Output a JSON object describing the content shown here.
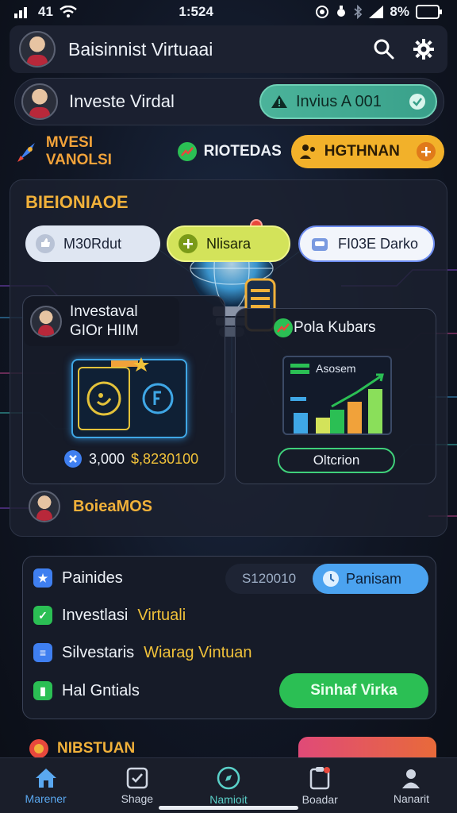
{
  "status_bar": {
    "signal_text": "41",
    "time": "1:524",
    "battery": "8%"
  },
  "app_bar": {
    "title": "Baisinnist Virtuaai",
    "icons": [
      "search-icon",
      "gear-icon"
    ]
  },
  "profile_bar": {
    "name": "Investe Virdal",
    "invite_label": "Invius A 001"
  },
  "chips": {
    "chip1": "MVESI VANOLSI",
    "chip2": "RIOTEDAS",
    "chip3": "HGTHNAN"
  },
  "panel": {
    "section_title": "BIEIONIAOE",
    "pills": [
      "M30Rdut",
      "Nlisara",
      "FI03E Darko"
    ],
    "left_card": {
      "user_line1": "Investaval",
      "user_line2": "GIOr HIIM",
      "money1": "3,000",
      "money2": "$,8230100"
    },
    "right_card": {
      "title": "Pola Kubars",
      "chart_label": "Asosem",
      "button": "Oltcrion"
    }
  },
  "boards_title": "BoieaMOS",
  "list": {
    "rows": [
      {
        "label": "Painides",
        "highlight": ""
      },
      {
        "label": "Investlasi",
        "highlight": "Virtuali"
      },
      {
        "label": "Silvestaris",
        "highlight": "Wiarag Vintuan"
      },
      {
        "label": "Hal Gntials",
        "highlight": ""
      }
    ],
    "amount": "S120010",
    "amount_button": "Panisam",
    "action_button": "Sinhaf Virka"
  },
  "peek_title": "NIBSTUAN",
  "bottom_nav": [
    "Marener",
    "Shage",
    "Namioit",
    "Boadar",
    "Nanarit"
  ],
  "colors": {
    "accent_orange": "#f1b13a",
    "teal": "#4bb39a",
    "yellow": "#f2b12a",
    "lime": "#d3e35a",
    "green": "#2bbf54",
    "blue": "#4ba3f0",
    "background": "#0d1018"
  }
}
